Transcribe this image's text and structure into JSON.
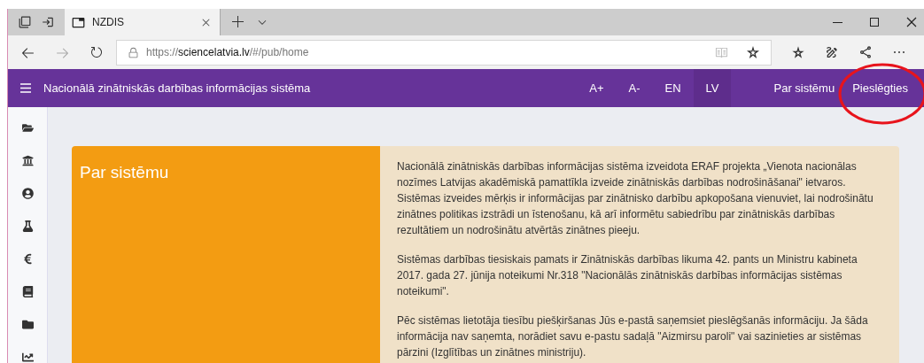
{
  "browser": {
    "tab_title": "NZDIS",
    "url_prefix": "https://",
    "url_host": "sciencelatvia.lv",
    "url_path": "/#/pub/home"
  },
  "header": {
    "title": "Nacionālā zinātniskās darbības informācijas sistēma",
    "font_controls": [
      "A+",
      "A-"
    ],
    "languages": [
      {
        "label": "EN",
        "selected": false
      },
      {
        "label": "LV",
        "selected": true
      }
    ],
    "menu": [
      "Par sistēmu",
      "Pieslēgties"
    ]
  },
  "card": {
    "title": "Par sistēmu",
    "paragraphs": [
      "Nacionālā zinātniskās darbības informācijas sistēma izveidota ERAF projekta „Vienota nacionālas nozīmes Latvijas akadēmiskā pamattīkla izveide zinātniskās darbības nodrošināšanai\"  ietvaros. Sistēmas izveides mērķis ir informācijas par zinātnisko darbību apkopošana vienuviet, lai nodrošinātu zinātnes politikas izstrādi un īstenošanu, kā arī informētu sabiedrību par zinātniskās darbības rezultātiem un nodrošinātu atvērtās zinātnes pieeju.",
      "Sistēmas darbības tiesiskais pamats ir Zinātniskās darbības likuma 42. pants un Ministru kabineta 2017. gada 27. jūnija noteikumi Nr.318 \"Nacionālās zinātniskās darbības informācijas sistēmas noteikumi\".",
      "Pēc sistēmas lietotāja tiesību piešķiršanas Jūs e-pastā saņemsiet pieslēgšanās informāciju. Ja šāda informācija nav saņemta, norādiet savu e-pastu sadaļā \"Aizmirsu paroli\" vai sazinieties ar sistēmas pārzini (Izglītības un zinātnes ministriju)."
    ]
  }
}
